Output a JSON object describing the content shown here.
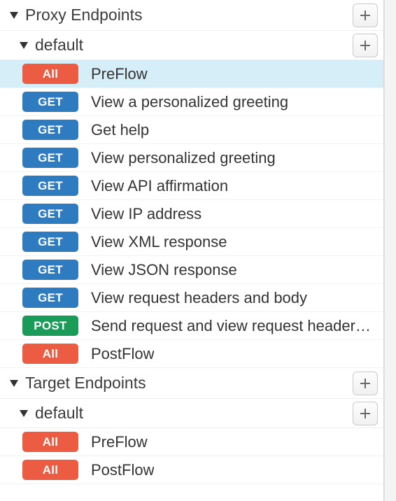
{
  "sections": [
    {
      "title": "Proxy Endpoints",
      "has_add": true,
      "subsections": [
        {
          "title": "default",
          "has_add": true,
          "flows": [
            {
              "method": "All",
              "label": "PreFlow",
              "highlight": true
            },
            {
              "method": "GET",
              "label": "View a personalized greeting"
            },
            {
              "method": "GET",
              "label": "Get help"
            },
            {
              "method": "GET",
              "label": "View personalized greeting"
            },
            {
              "method": "GET",
              "label": "View API affirmation"
            },
            {
              "method": "GET",
              "label": "View IP address"
            },
            {
              "method": "GET",
              "label": "View XML response"
            },
            {
              "method": "GET",
              "label": "View JSON response"
            },
            {
              "method": "GET",
              "label": "View request headers and body"
            },
            {
              "method": "POST",
              "label": "Send request and view request headers and body"
            },
            {
              "method": "All",
              "label": "PostFlow"
            }
          ]
        }
      ]
    },
    {
      "title": "Target Endpoints",
      "has_add": true,
      "subsections": [
        {
          "title": "default",
          "has_add": true,
          "flows": [
            {
              "method": "All",
              "label": "PreFlow"
            },
            {
              "method": "All",
              "label": "PostFlow"
            }
          ]
        }
      ]
    }
  ],
  "method_styles": {
    "All": "badge-all",
    "GET": "badge-get",
    "POST": "badge-post"
  }
}
